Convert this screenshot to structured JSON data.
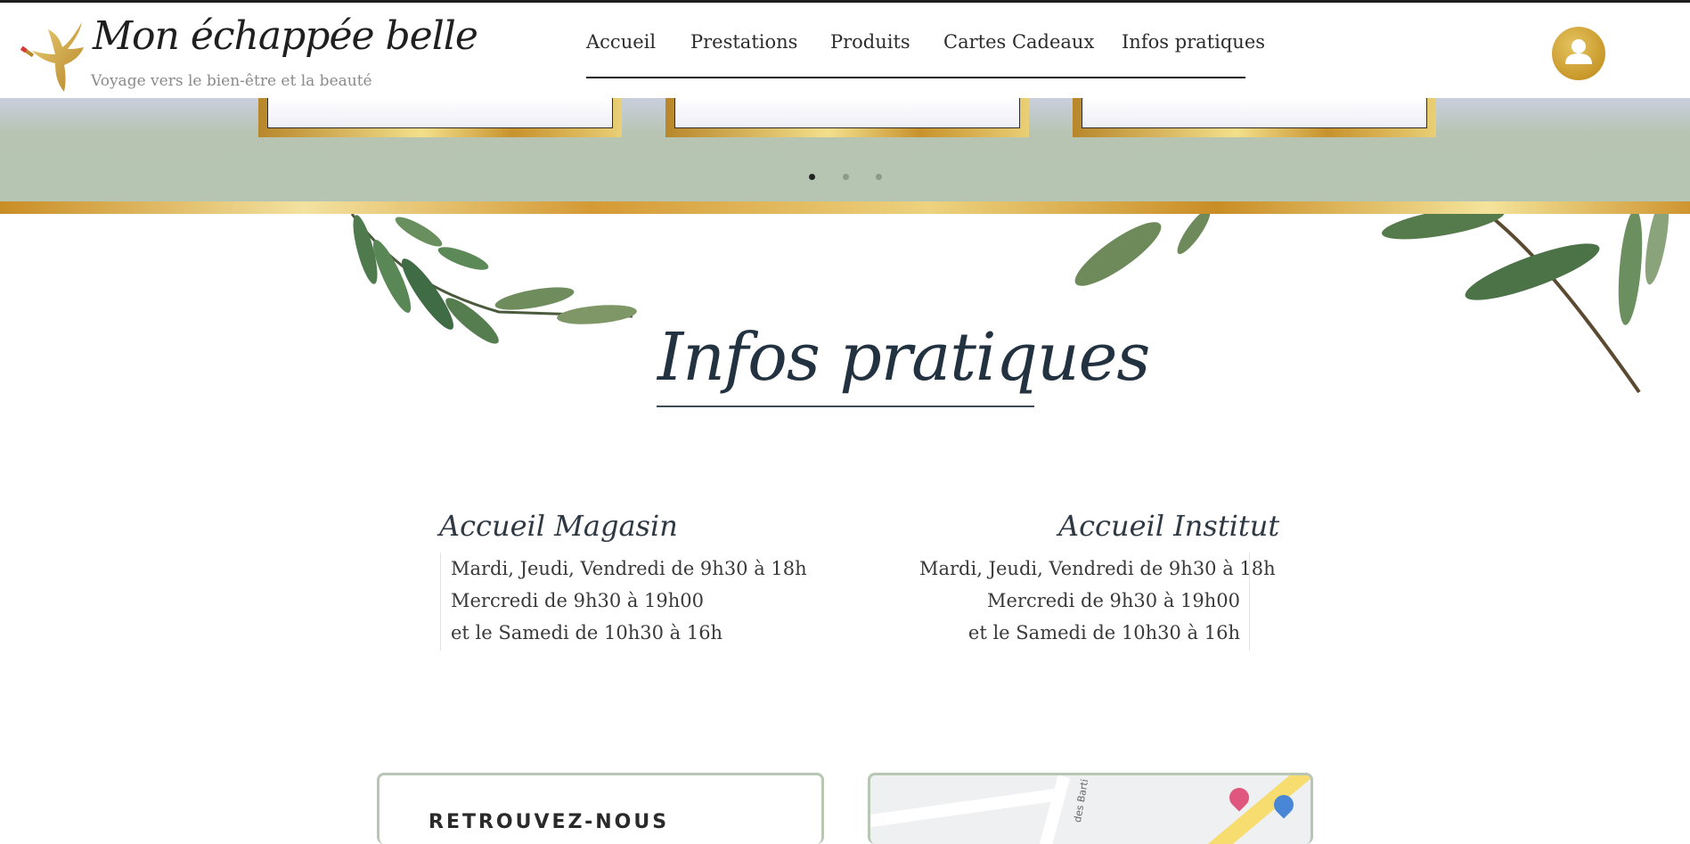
{
  "brand": {
    "title": "Mon échappée belle",
    "tagline": "Voyage vers le bien-être et la beauté"
  },
  "nav": {
    "items": [
      "Accueil",
      "Prestations",
      "Produits",
      "Cartes Cadeaux",
      "Infos pratiques"
    ]
  },
  "account": {
    "icon": "user-icon"
  },
  "carousel": {
    "slides": 3,
    "active_index": 0
  },
  "section": {
    "title": "Infos pratiques"
  },
  "hours": {
    "magasin": {
      "title": "Accueil Magasin",
      "lines": [
        "Mardi, Jeudi, Vendredi de 9h30 à 18h",
        "Mercredi de 9h30 à 19h00",
        "et le Samedi de 10h30 à 16h"
      ]
    },
    "institut": {
      "title": "Accueil Institut",
      "lines": [
        "Mardi, Jeudi, Vendredi de 9h30 à 18h",
        "Mercredi de 9h30 à 19h00",
        "et le Samedi de 10h30 à 16h"
      ]
    }
  },
  "contact_panel": {
    "heading": "RETROUVEZ-NOUS"
  },
  "map": {
    "street_label": "des Barti"
  },
  "colors": {
    "gold": "#c9982a",
    "sage": "#b6c4b2",
    "panel_border": "#b8c6b4",
    "text_dark": "#233240"
  }
}
